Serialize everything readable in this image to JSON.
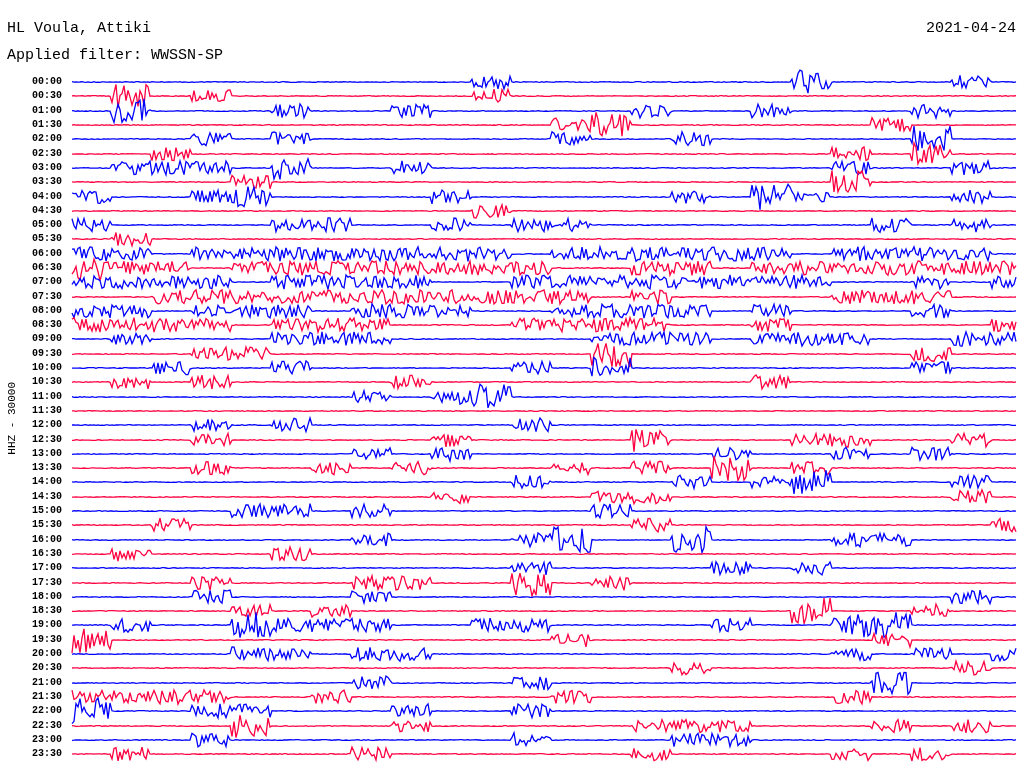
{
  "station": "HL Voula, Attiki",
  "date": "2021-04-24",
  "filter": "Applied filter: WWSSN-SP",
  "axis_label": "HHZ - 30000",
  "rows": [
    {
      "time": "00:00",
      "color": "#0000ff"
    },
    {
      "time": "00:30",
      "color": "#ff0040"
    },
    {
      "time": "01:00",
      "color": "#0000ff"
    },
    {
      "time": "01:30",
      "color": "#ff0040"
    },
    {
      "time": "02:00",
      "color": "#0000ff"
    },
    {
      "time": "02:30",
      "color": "#ff0040"
    },
    {
      "time": "03:00",
      "color": "#0000ff"
    },
    {
      "time": "03:30",
      "color": "#ff0040"
    },
    {
      "time": "04:00",
      "color": "#0000ff"
    },
    {
      "time": "04:30",
      "color": "#ff0040"
    },
    {
      "time": "05:00",
      "color": "#0000ff"
    },
    {
      "time": "05:30",
      "color": "#ff0040"
    },
    {
      "time": "06:00",
      "color": "#0000ff"
    },
    {
      "time": "06:30",
      "color": "#ff0040"
    },
    {
      "time": "07:00",
      "color": "#0000ff"
    },
    {
      "time": "07:30",
      "color": "#ff0040"
    },
    {
      "time": "08:00",
      "color": "#0000ff"
    },
    {
      "time": "08:30",
      "color": "#ff0040"
    },
    {
      "time": "09:00",
      "color": "#0000ff"
    },
    {
      "time": "09:30",
      "color": "#ff0040"
    },
    {
      "time": "10:00",
      "color": "#0000ff"
    },
    {
      "time": "10:30",
      "color": "#ff0040"
    },
    {
      "time": "11:00",
      "color": "#0000ff"
    },
    {
      "time": "11:30",
      "color": "#ff0040"
    },
    {
      "time": "12:00",
      "color": "#0000ff"
    },
    {
      "time": "12:30",
      "color": "#ff0040"
    },
    {
      "time": "13:00",
      "color": "#0000ff"
    },
    {
      "time": "13:30",
      "color": "#ff0040"
    },
    {
      "time": "14:00",
      "color": "#0000ff"
    },
    {
      "time": "14:30",
      "color": "#ff0040"
    },
    {
      "time": "15:00",
      "color": "#0000ff"
    },
    {
      "time": "15:30",
      "color": "#ff0040"
    },
    {
      "time": "16:00",
      "color": "#0000ff"
    },
    {
      "time": "16:30",
      "color": "#ff0040"
    },
    {
      "time": "17:00",
      "color": "#0000ff"
    },
    {
      "time": "17:30",
      "color": "#ff0040"
    },
    {
      "time": "18:00",
      "color": "#0000ff"
    },
    {
      "time": "18:30",
      "color": "#ff0040"
    },
    {
      "time": "19:00",
      "color": "#0000ff"
    },
    {
      "time": "19:30",
      "color": "#ff0040"
    },
    {
      "time": "20:00",
      "color": "#0000ff"
    },
    {
      "time": "20:30",
      "color": "#ff0040"
    },
    {
      "time": "21:00",
      "color": "#0000ff"
    },
    {
      "time": "21:30",
      "color": "#ff0040"
    },
    {
      "time": "22:00",
      "color": "#0000ff"
    },
    {
      "time": "22:30",
      "color": "#ff0040"
    },
    {
      "time": "23:00",
      "color": "#0000ff"
    },
    {
      "time": "23:30",
      "color": "#ff0040"
    }
  ]
}
